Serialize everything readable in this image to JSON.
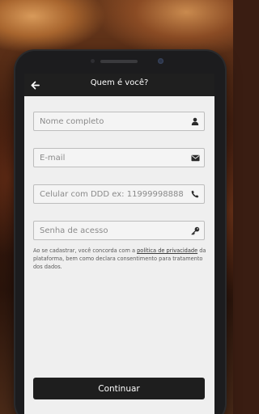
{
  "header": {
    "title": "Quem é você?"
  },
  "form": {
    "name_placeholder": "Nome completo",
    "email_placeholder": "E-mail",
    "phone_placeholder": "Celular com DDD ex: 11999998888",
    "password_placeholder": "Senha de acesso"
  },
  "terms": {
    "prefix": "Ao se cadastrar, você concorda com a ",
    "link": "política de privacidade",
    "suffix": " da plataforma, bem como declara consentimento para tratamento dos dados."
  },
  "actions": {
    "continue_label": "Continuar"
  },
  "icons": {
    "back": "arrow-left-icon",
    "name": "user-icon",
    "email": "envelope-icon",
    "phone": "phone-icon",
    "password": "key-icon"
  },
  "colors": {
    "appbar": "#1f1f1f",
    "screen_bg": "#efefef",
    "button": "#1e1e1e",
    "field_border": "#bdbdbd"
  }
}
